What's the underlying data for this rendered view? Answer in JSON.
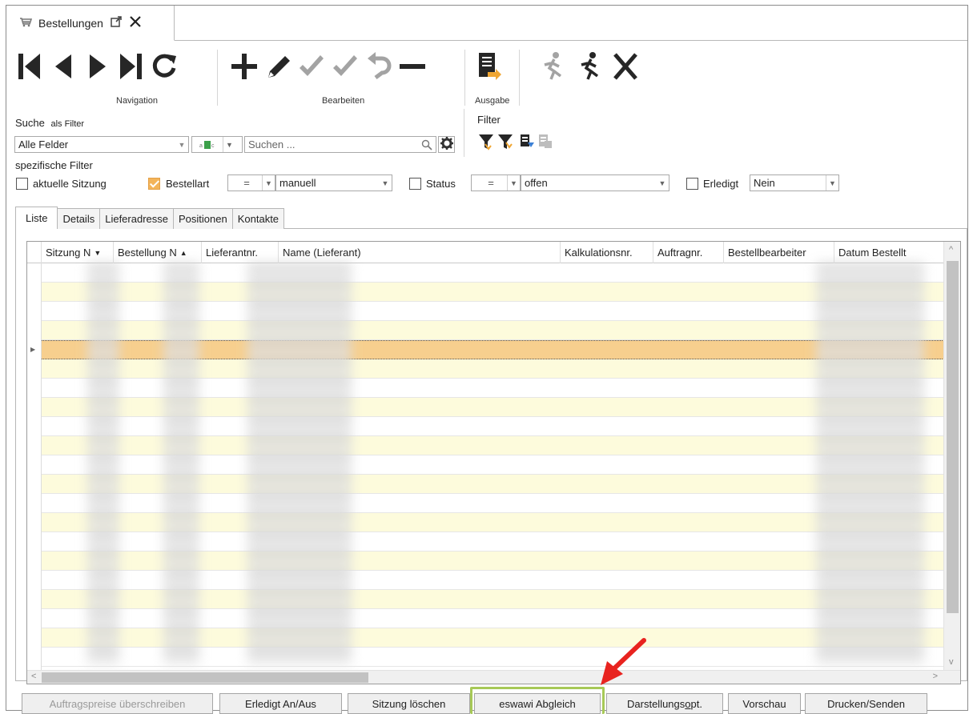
{
  "window": {
    "tab_title": "Bestellungen",
    "icons": [
      "cart-icon",
      "external-link-icon",
      "close-icon"
    ]
  },
  "toolbar": {
    "groups": {
      "navigation": "Navigation",
      "bearbeiten": "Bearbeiten",
      "ausgabe": "Ausgabe"
    }
  },
  "search": {
    "label": "Suche",
    "filter_hint": "als Filter",
    "field_value": "Alle Felder",
    "placeholder": "Suchen ..."
  },
  "filter": {
    "label": "Filter"
  },
  "specific_filters": {
    "label": "spezifische Filter",
    "session": {
      "label": "aktuelle Sitzung",
      "checked": false
    },
    "order_type": {
      "label": "Bestellart",
      "checked": true,
      "operator": "=",
      "value": "manuell"
    },
    "status": {
      "label": "Status",
      "checked": false,
      "operator": "=",
      "value": "offen"
    },
    "done": {
      "label": "Erledigt",
      "checked": false,
      "value": "Nein"
    }
  },
  "tabs": [
    "Liste",
    "Details",
    "Lieferadresse",
    "Positionen",
    "Kontakte"
  ],
  "grid": {
    "columns": [
      "Sitzung N",
      "Bestellung N",
      "Lieferantnr.",
      "Name (Lieferant)",
      "Kalkulationsnr.",
      "Auftragnr.",
      "Bestellbearbeiter",
      "Datum Bestellt"
    ],
    "sort_glyphs": [
      "▼",
      "▲"
    ],
    "selected_row_color": "#f7cf8e",
    "alt_row_color": "#fdfbdc"
  },
  "buttons": {
    "overwrite_prices": "Auftragspreise überschreiben",
    "toggle_done": "Erledigt An/Aus",
    "delete_session": "Sitzung löschen",
    "eswawi_sync": "eswawi Abgleich",
    "display_options_pre": "Darstellungs",
    "display_options_u": "o",
    "display_options_post": "pt.",
    "preview": "Vorschau",
    "print_send": "Drucken/Senden"
  },
  "accent": {
    "highlight_box": "#a7c957",
    "arrow": "#e8231f"
  }
}
